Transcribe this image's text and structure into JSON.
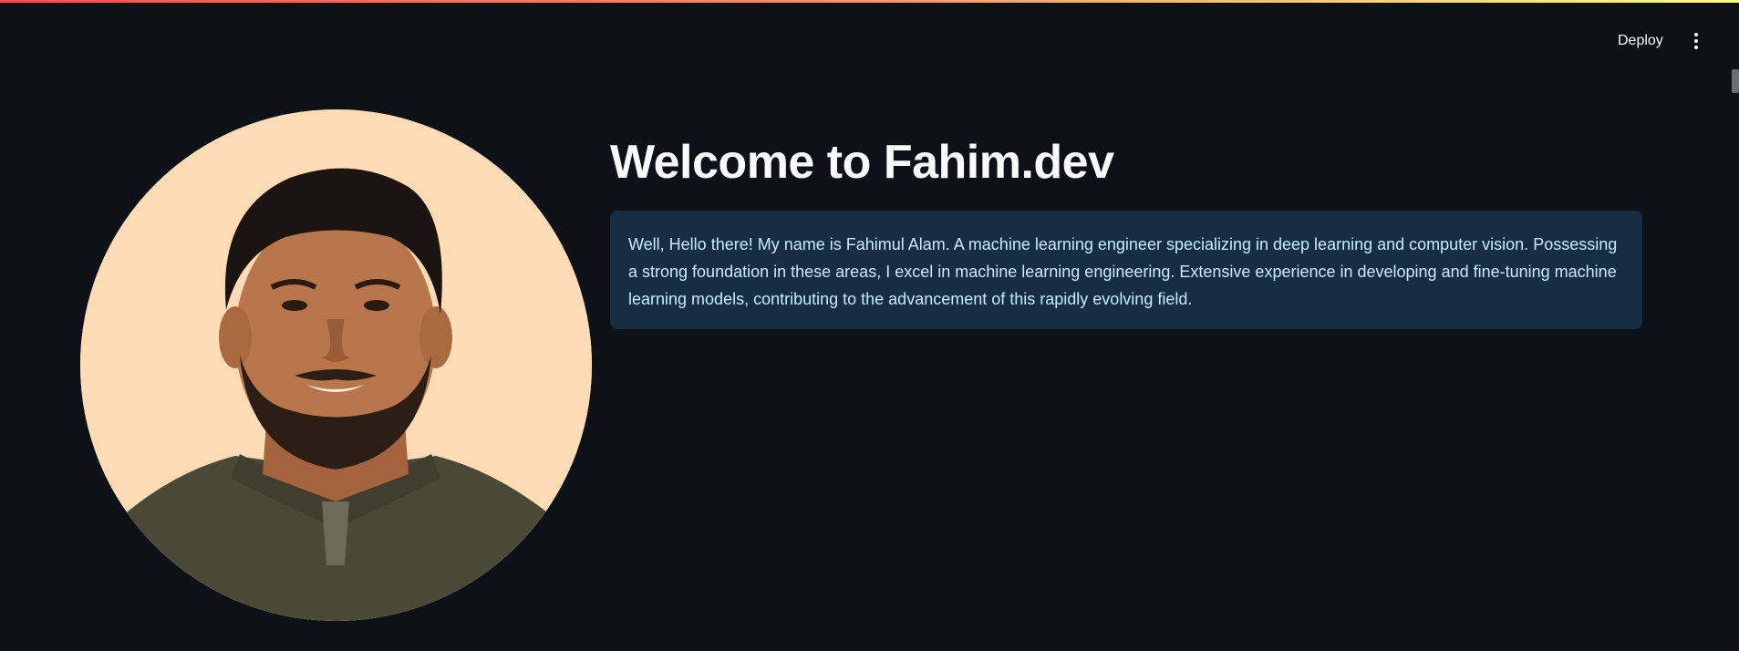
{
  "header": {
    "deploy_label": "Deploy",
    "menu_icon": "vertical-ellipsis-icon"
  },
  "profile": {
    "photo_icon": "profile-photo"
  },
  "main": {
    "title": "Welcome to Fahim.dev",
    "intro": "Well, Hello there! My name is Fahimul Alam. A machine learning engineer specializing in deep learning and computer vision. Possessing a strong foundation in these areas, I excel in machine learning engineering. Extensive experience in developing and fine-tuning machine learning models, contributing to the advancement of this rapidly evolving field."
  },
  "colors": {
    "background": "#0e1117",
    "info_bg": "#172d43",
    "info_text": "#c7ebff",
    "accent_gradient_start": "#ff4b4b",
    "accent_gradient_end": "#fffd80"
  }
}
